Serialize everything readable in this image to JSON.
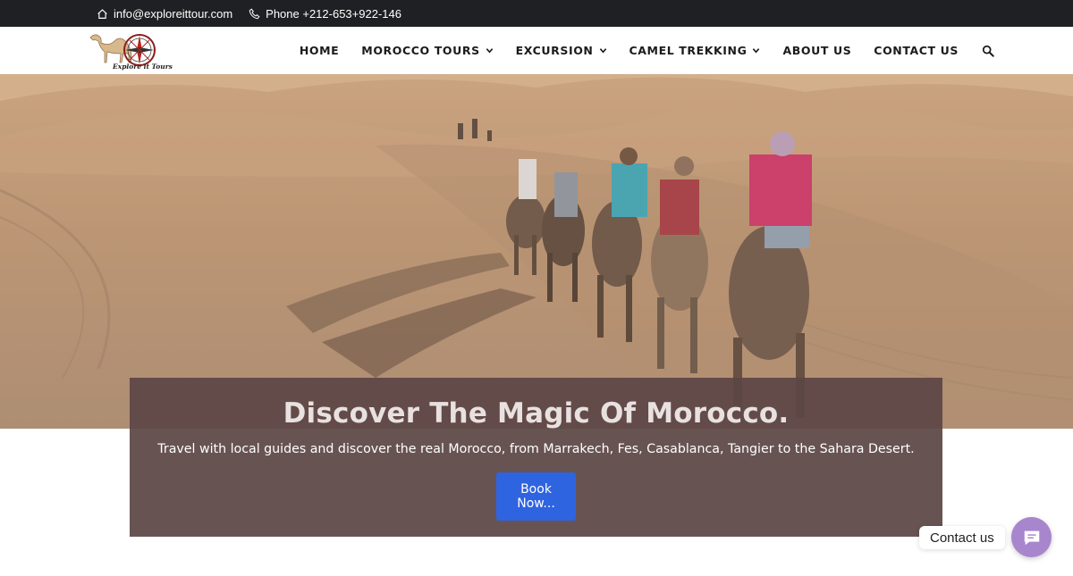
{
  "topbar": {
    "email": "info@exploreittour.com",
    "phone": "Phone +212-653+922-146",
    "icons": [
      "home-icon",
      "phone-icon"
    ]
  },
  "logo": {
    "text": "Explore it Tours"
  },
  "nav": {
    "items": [
      {
        "label": "HOME",
        "dropdown": false
      },
      {
        "label": "MOROCCO TOURS",
        "dropdown": true
      },
      {
        "label": "EXCURSION",
        "dropdown": true
      },
      {
        "label": "CAMEL TREKKING",
        "dropdown": true
      },
      {
        "label": "ABOUT US",
        "dropdown": false
      },
      {
        "label": "CONTACT US",
        "dropdown": false
      }
    ],
    "search_icon": "search-icon"
  },
  "hero": {
    "title": "Discover The Magic Of Morocco.",
    "subtitle": "Travel with local guides and discover the real Morocco, from Marrakech, Fes, Casablanca, Tangier to the Sahara Desert.",
    "button": "Book Now..."
  },
  "contact_widget": {
    "label": "Contact us",
    "icon": "chat-icon",
    "color": "#a886cd"
  },
  "colors": {
    "topbar": "#1f2023",
    "button": "#2f64e0",
    "caption_bg": "#5c4646"
  }
}
